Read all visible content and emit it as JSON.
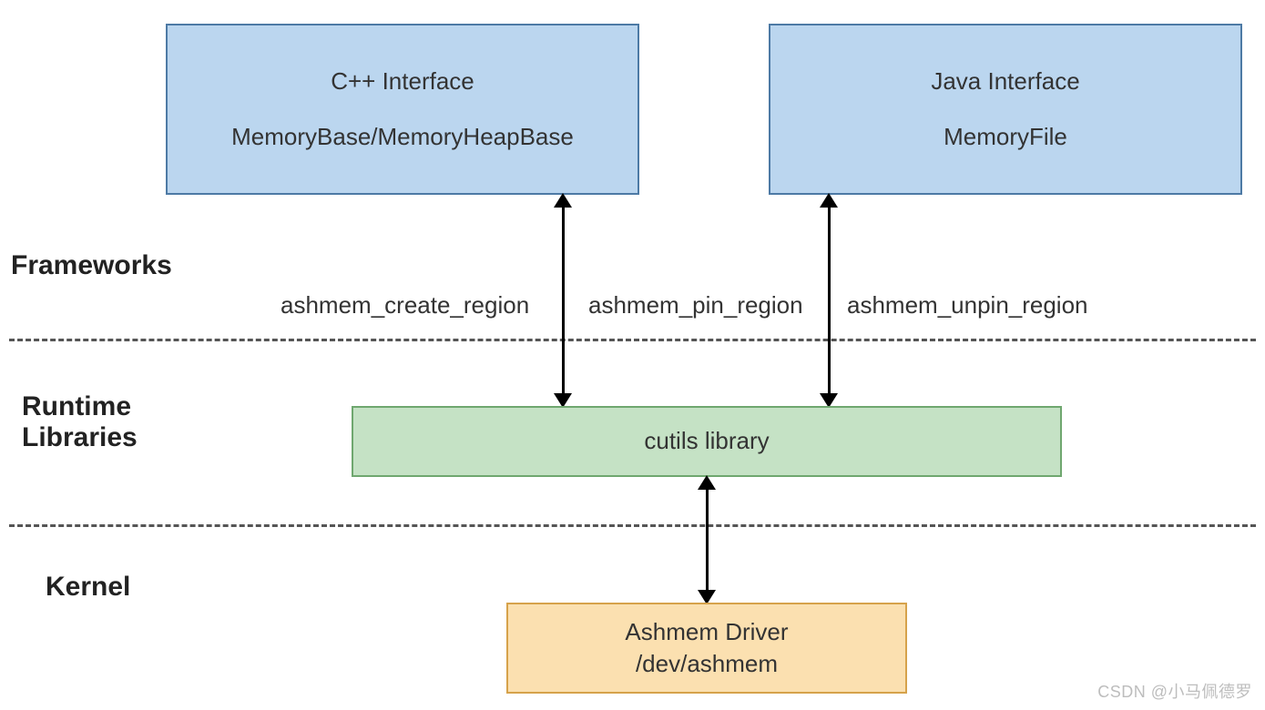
{
  "sections": {
    "frameworks": "Frameworks",
    "runtime": "Runtime\nLibraries",
    "kernel": "Kernel"
  },
  "boxes": {
    "cpp": {
      "title": "C++ Interface",
      "sub": "MemoryBase/MemoryHeapBase"
    },
    "java": {
      "title": "Java Interface",
      "sub": "MemoryFile"
    },
    "cutils": {
      "title": "cutils library"
    },
    "driver": {
      "title": "Ashmem Driver",
      "sub": "/dev/ashmem"
    }
  },
  "apis": {
    "create": "ashmem_create_region",
    "pin": "ashmem_pin_region",
    "unpin": "ashmem_unpin_region"
  },
  "colors": {
    "blue": "#bbd6ef",
    "green": "#c5e2c5",
    "orange": "#fbe0b0"
  },
  "watermark": "CSDN @小马佩德罗"
}
